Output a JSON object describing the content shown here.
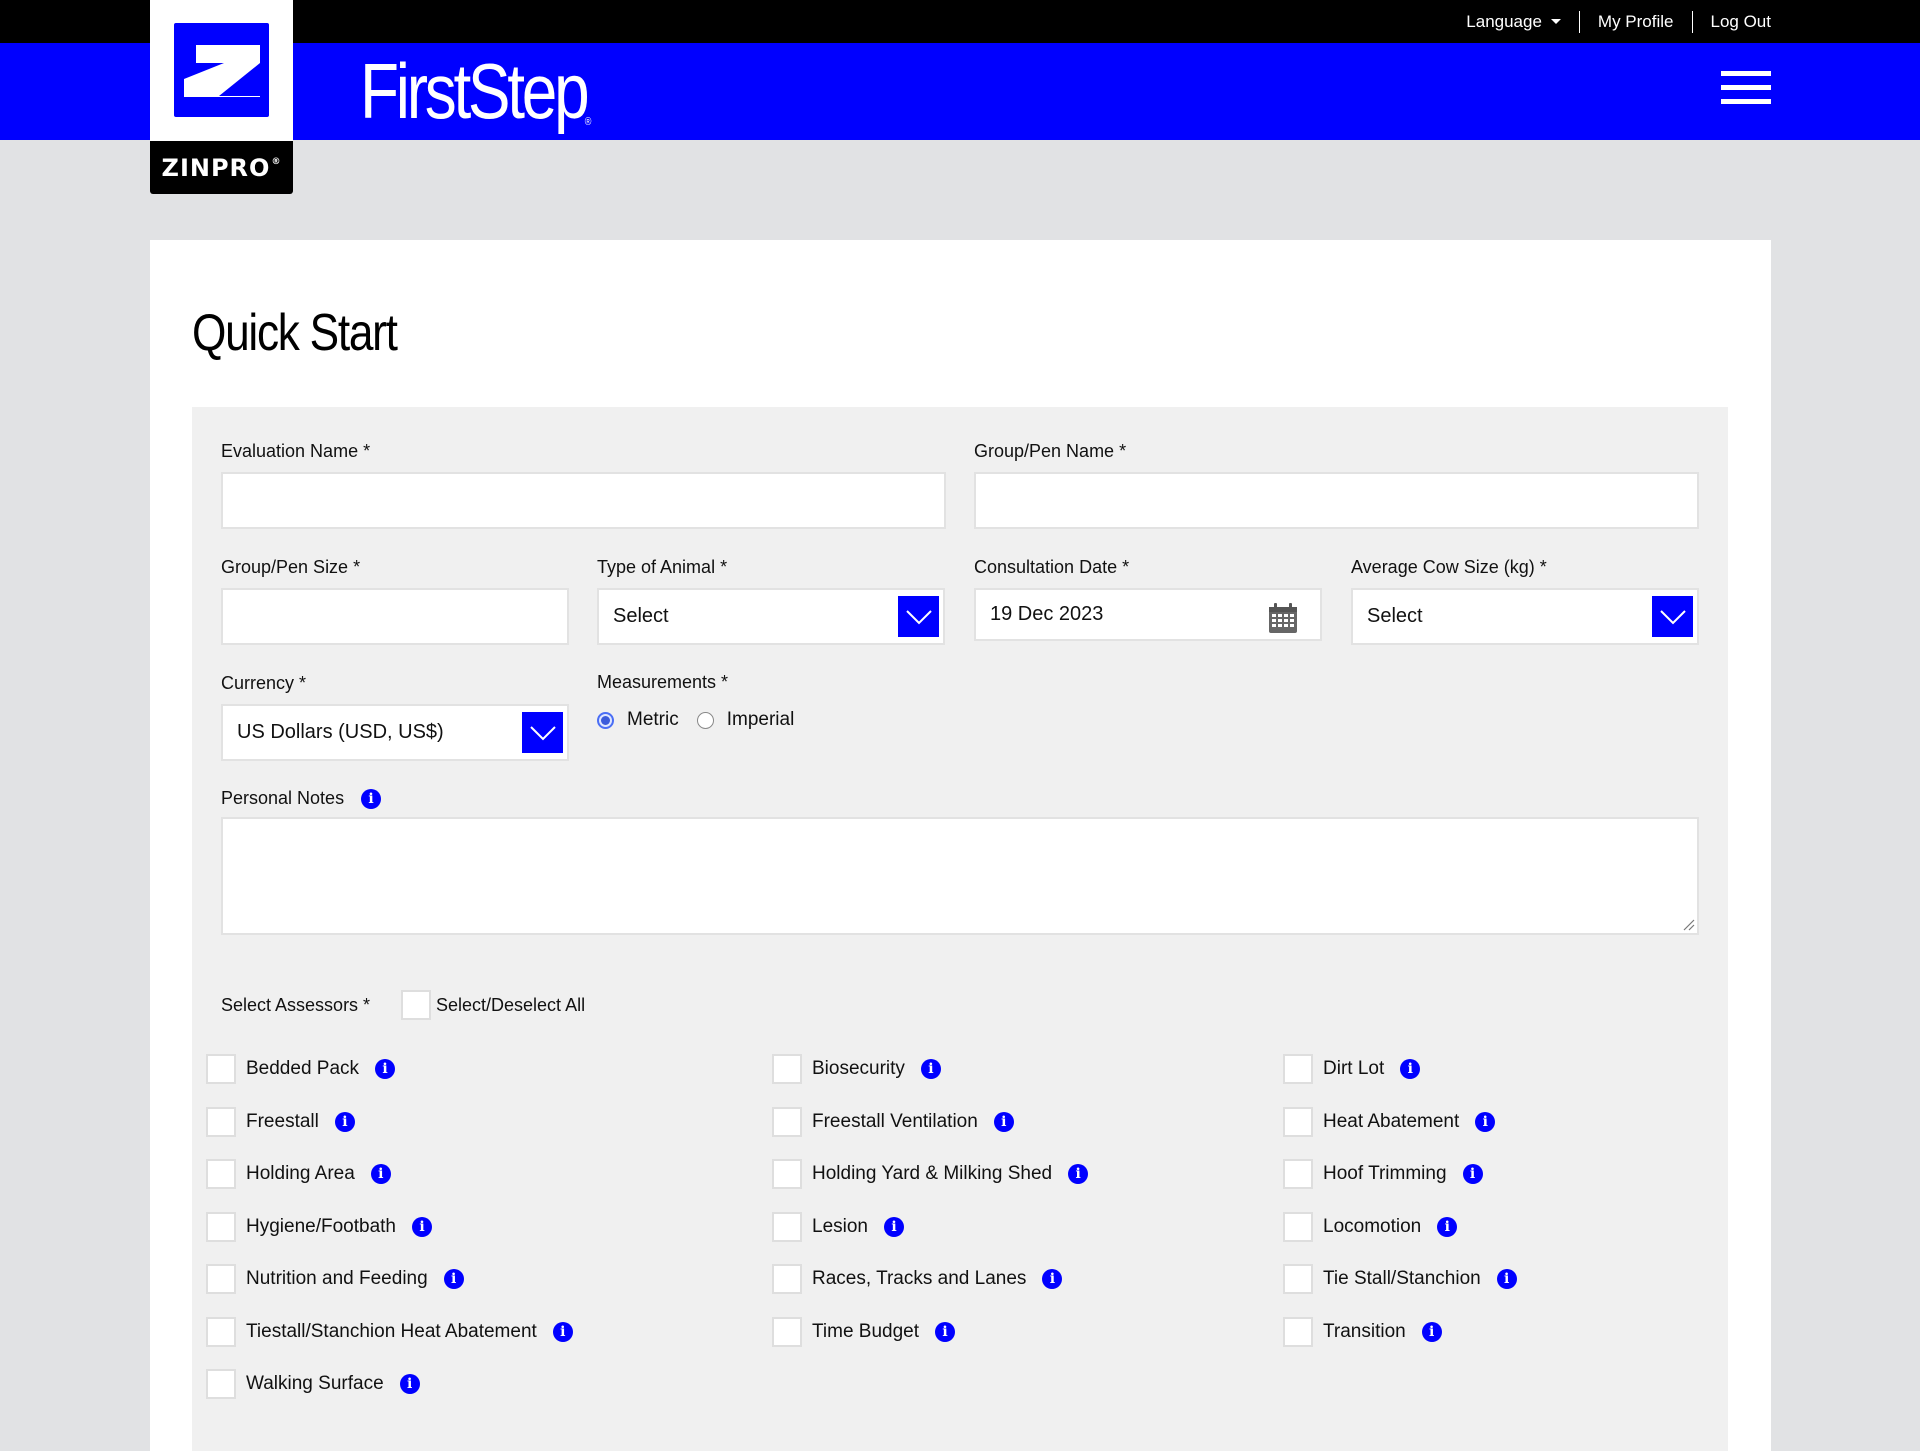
{
  "colors": {
    "brand_blue": "#0000ff",
    "topbar": "#000000",
    "page_bg": "#e1e2e4",
    "panel_bg": "#f0f0f0"
  },
  "topnav": {
    "language": "Language",
    "my_profile": "My Profile",
    "log_out": "Log Out"
  },
  "logo": {
    "company": "ZINPRO",
    "registered": "®"
  },
  "brand": {
    "name": "FirstStep",
    "registered": "®"
  },
  "page": {
    "title": "Quick Start"
  },
  "form": {
    "evaluation_name": {
      "label": "Evaluation Name *",
      "value": ""
    },
    "group_pen_name": {
      "label": "Group/Pen Name *",
      "value": ""
    },
    "group_pen_size": {
      "label": "Group/Pen Size *",
      "value": ""
    },
    "type_of_animal": {
      "label": "Type of Animal *",
      "value": "Select"
    },
    "consultation_date": {
      "label": "Consultation Date *",
      "value": "19 Dec 2023"
    },
    "average_cow_size": {
      "label": "Average Cow Size (kg) *",
      "value": "Select"
    },
    "currency": {
      "label": "Currency *",
      "value": "US Dollars (USD, US$)"
    },
    "measurements": {
      "label": "Measurements *",
      "options": [
        {
          "label": "Metric",
          "selected": true
        },
        {
          "label": "Imperial",
          "selected": false
        }
      ]
    },
    "personal_notes": {
      "label": "Personal Notes",
      "value": ""
    },
    "assessors": {
      "label": "Select Assessors *",
      "select_all_label": "Select/Deselect All",
      "select_all_checked": false,
      "columns": [
        [
          {
            "label": "Bedded Pack",
            "checked": false
          },
          {
            "label": "Freestall",
            "checked": false
          },
          {
            "label": "Holding Area",
            "checked": false
          },
          {
            "label": "Hygiene/Footbath",
            "checked": false
          },
          {
            "label": "Nutrition and Feeding",
            "checked": false
          },
          {
            "label": "Tiestall/Stanchion Heat Abatement",
            "checked": false
          },
          {
            "label": "Walking Surface",
            "checked": false
          }
        ],
        [
          {
            "label": "Biosecurity",
            "checked": false
          },
          {
            "label": "Freestall Ventilation",
            "checked": false
          },
          {
            "label": "Holding Yard & Milking Shed",
            "checked": false
          },
          {
            "label": "Lesion",
            "checked": false
          },
          {
            "label": "Races, Tracks and Lanes",
            "checked": false
          },
          {
            "label": "Time Budget",
            "checked": false
          }
        ],
        [
          {
            "label": "Dirt Lot",
            "checked": false
          },
          {
            "label": "Heat Abatement",
            "checked": false
          },
          {
            "label": "Hoof Trimming",
            "checked": false
          },
          {
            "label": "Locomotion",
            "checked": false
          },
          {
            "label": "Tie Stall/Stanchion",
            "checked": false
          },
          {
            "label": "Transition",
            "checked": false
          }
        ]
      ]
    }
  }
}
